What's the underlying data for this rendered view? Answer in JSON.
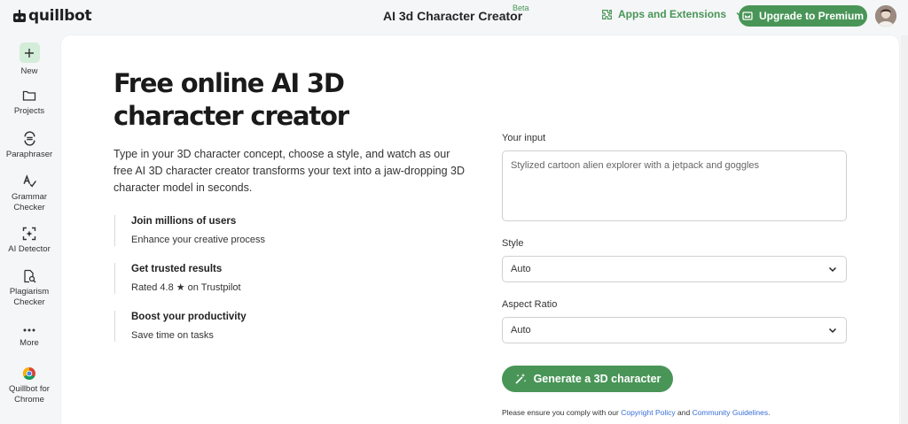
{
  "header": {
    "logo": "quillbot",
    "title": "AI 3d Character Creator",
    "beta": "Beta",
    "apps": "Apps and Extensions",
    "upgrade": "Upgrade to Premium"
  },
  "sidebar": {
    "items": [
      {
        "label": "New",
        "icon": "plus-icon"
      },
      {
        "label": "Projects",
        "icon": "folder-icon"
      },
      {
        "label": "Paraphraser",
        "icon": "paraphraser-icon"
      },
      {
        "label": "Grammar Checker",
        "icon": "grammar-icon"
      },
      {
        "label": "AI Detector",
        "icon": "ai-detector-icon"
      },
      {
        "label": "Plagiarism Checker",
        "icon": "plagiarism-icon"
      },
      {
        "label": "More",
        "icon": "more-icon"
      },
      {
        "label": "Quillbot for Chrome",
        "icon": "chrome-icon"
      }
    ]
  },
  "main": {
    "title": "Free online AI 3D character creator",
    "description": "Type in your 3D character concept, choose a style, and watch as our free AI 3D character creator transforms your text into a jaw-dropping 3D character model in seconds.",
    "features": [
      {
        "title": "Join millions of users",
        "text": "Enhance your creative process"
      },
      {
        "title": "Get trusted results",
        "text": "Rated 4.8 ★ on Trustpilot"
      },
      {
        "title": "Boost your productivity",
        "text": "Save time on tasks"
      }
    ],
    "form": {
      "input_label": "Your input",
      "input_placeholder": "Stylized cartoon alien explorer with a jetpack and goggles",
      "style_label": "Style",
      "style_value": "Auto",
      "aspect_label": "Aspect Ratio",
      "aspect_value": "Auto",
      "generate": "Generate a 3D character",
      "notice_pre": "Please ensure you comply with our",
      "copyright_link": "Copyright Policy",
      "notice_and": "and",
      "guidelines_link": "Community Guidelines",
      "notice_end": "."
    }
  },
  "colors": {
    "accent": "#499557",
    "accent_light": "#d4edd9",
    "link": "#3a6fd8"
  }
}
